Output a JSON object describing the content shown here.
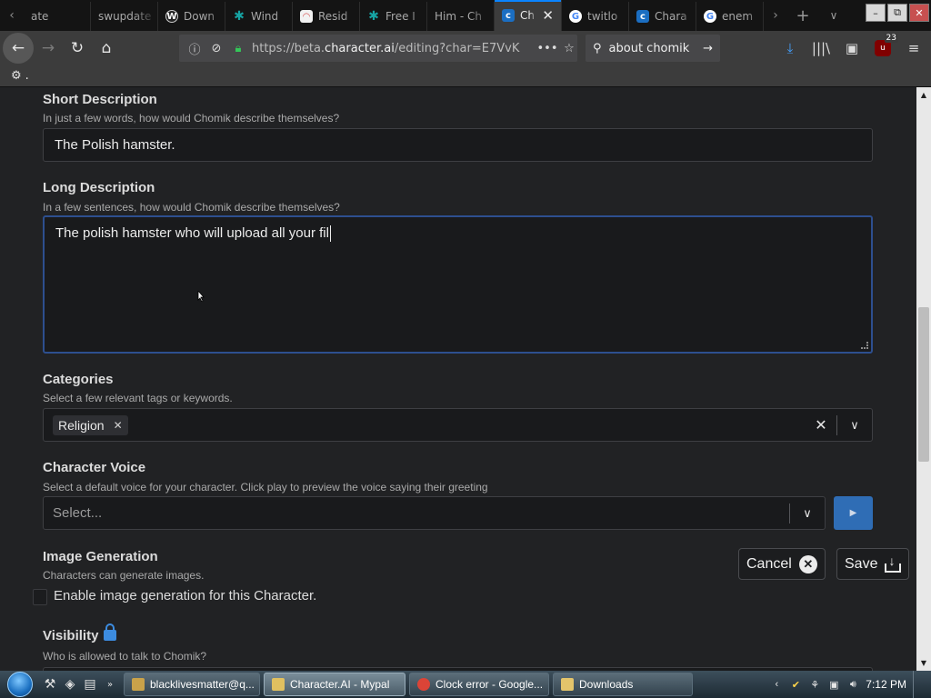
{
  "browser": {
    "tabs": [
      {
        "title": "ate",
        "icon": "tab-icon",
        "color": "#2c2c2c"
      },
      {
        "title": "swupdate",
        "icon": "none",
        "color": "#2c2c2c"
      },
      {
        "title": "Down",
        "icon": "wordpress-icon",
        "color": "#222222"
      },
      {
        "title": "Wind",
        "icon": "puzzle-icon",
        "color": "#16a3a3"
      },
      {
        "title": "Resid",
        "icon": "rainbow-icon",
        "color": "#d44b4b"
      },
      {
        "title": "Free I",
        "icon": "puzzle-icon",
        "color": "#16a3a3"
      },
      {
        "title": "Him - Ch",
        "icon": "none",
        "color": "#2c2c2c"
      },
      {
        "title": "Ch",
        "icon": "character-ai-icon",
        "color": "#1b6ec2",
        "active": true
      },
      {
        "title": "twitlo",
        "icon": "google-icon",
        "color": "#ffffff"
      },
      {
        "title": "Chara",
        "icon": "character-ai-icon",
        "color": "#1b6ec2"
      },
      {
        "title": "enem",
        "icon": "google-icon",
        "color": "#ffffff"
      }
    ],
    "url_prefix": "https://beta.",
    "url_domain": "character.ai",
    "url_suffix": "/editing?char=E7VvK",
    "search_text": "about chomik",
    "ublock_badge": "23",
    "bookmark_text": "."
  },
  "form": {
    "short_desc": {
      "title": "Short Description",
      "hint": "In just a few words, how would Chomik describe themselves?",
      "value": "The Polish hamster."
    },
    "long_desc": {
      "title": "Long Description",
      "hint": "In a few sentences, how would Chomik describe themselves?",
      "value": "The polish hamster who will upload all your fil"
    },
    "categories": {
      "title": "Categories",
      "hint": "Select a few relevant tags or keywords.",
      "chips": [
        "Religion"
      ]
    },
    "voice": {
      "title": "Character Voice",
      "hint": "Select a default voice for your character. Click play to preview the voice saying their greeting",
      "placeholder": "Select..."
    },
    "image_gen": {
      "title": "Image Generation",
      "hint": "Characters can generate images.",
      "checkbox_label": "Enable image generation for this Character."
    },
    "visibility": {
      "title": "Visibility",
      "hint": "Who is allowed to talk to Chomik?"
    },
    "cancel_label": "Cancel",
    "save_label": "Save"
  },
  "taskbar": {
    "buttons": [
      {
        "label": "blacklivesmatter@q...",
        "icon": "email-icon",
        "color": "#c9a24a"
      },
      {
        "label": "Character.AI - Mypal",
        "icon": "mypal-icon",
        "color": "#e0c060",
        "active": true
      },
      {
        "label": "Clock error - Google...",
        "icon": "chrome-icon",
        "color": "#db4437"
      },
      {
        "label": "Downloads",
        "icon": "folder-icon",
        "color": "#e3c46b"
      }
    ],
    "time": "7:12 PM"
  },
  "colors": {
    "accent": "#0a84ff",
    "play_button": "#2f6db5",
    "page_bg": "#212224",
    "textarea_focus": "#2d4f8f"
  }
}
